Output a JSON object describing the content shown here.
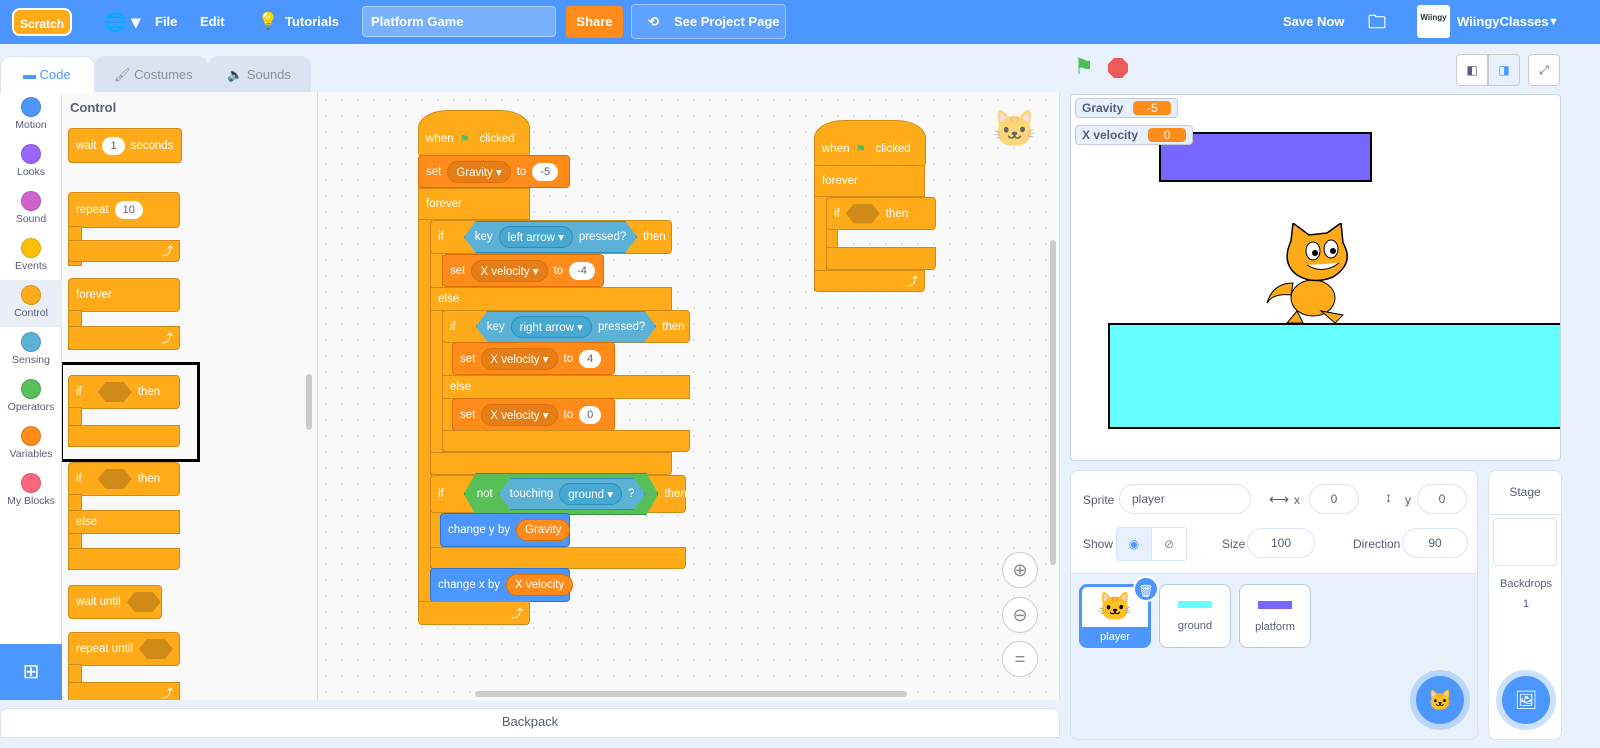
{
  "menubar": {
    "logo": "Scratch",
    "file": "File",
    "edit": "Edit",
    "tutorials": "Tutorials",
    "project_title": "Platform Game",
    "share": "Share",
    "see_project_page": "See Project Page",
    "save_now": "Save Now",
    "username": "WiingyClasses",
    "avatar_text": "Wiingy"
  },
  "tabs": {
    "code": "Code",
    "costumes": "Costumes",
    "sounds": "Sounds"
  },
  "categories": [
    {
      "label": "Motion",
      "color": "#4c97ff"
    },
    {
      "label": "Looks",
      "color": "#9966ff"
    },
    {
      "label": "Sound",
      "color": "#cf63cf"
    },
    {
      "label": "Events",
      "color": "#ffbf00"
    },
    {
      "label": "Control",
      "color": "#ffab19"
    },
    {
      "label": "Sensing",
      "color": "#5cb1d6"
    },
    {
      "label": "Operators",
      "color": "#59c059"
    },
    {
      "label": "Variables",
      "color": "#ff8c1a"
    },
    {
      "label": "My Blocks",
      "color": "#ff6680"
    }
  ],
  "palette": {
    "heading": "Control",
    "wait": "wait",
    "wait_value": "1",
    "seconds": "seconds",
    "repeat": "repeat",
    "repeat_value": "10",
    "forever": "forever",
    "if": "if",
    "then": "then",
    "else": "else",
    "wait_until": "wait until",
    "repeat_until": "repeat until"
  },
  "script1": {
    "when": "when",
    "clicked": "clicked",
    "set": "set",
    "gravity": "Gravity",
    "to": "to",
    "gravity_value": "-5",
    "forever": "forever",
    "if": "if",
    "key": "key",
    "left_arrow": "left arrow",
    "pressed": "pressed?",
    "then": "then",
    "x_velocity": "X velocity",
    "left_value": "-4",
    "else": "else",
    "right_arrow": "right arrow",
    "right_value": "4",
    "zero_value": "0",
    "not": "not",
    "touching": "touching",
    "ground": "ground",
    "question": "?",
    "change_y_by": "change y by",
    "change_x_by": "change x by"
  },
  "script2": {
    "when": "when",
    "clicked": "clicked",
    "forever": "forever",
    "if": "if",
    "then": "then"
  },
  "monitors": [
    {
      "name": "Gravity",
      "value": "-5"
    },
    {
      "name": "X velocity",
      "value": "0"
    }
  ],
  "stage_colors": {
    "platform": "#7766ff",
    "ground": "#66ffff"
  },
  "sprite_info": {
    "sprite_label": "Sprite",
    "sprite_name": "player",
    "x_label": "x",
    "x": "0",
    "y_label": "y",
    "y": "0",
    "show_label": "Show",
    "size_label": "Size",
    "size": "100",
    "direction_label": "Direction",
    "direction": "90"
  },
  "sprites": [
    {
      "name": "player",
      "selected": true
    },
    {
      "name": "ground"
    },
    {
      "name": "platform"
    }
  ],
  "stage_panel": {
    "title": "Stage",
    "backdrops_label": "Backdrops",
    "backdrops_count": "1"
  },
  "backpack": "Backpack",
  "accent": "#4c97ff"
}
